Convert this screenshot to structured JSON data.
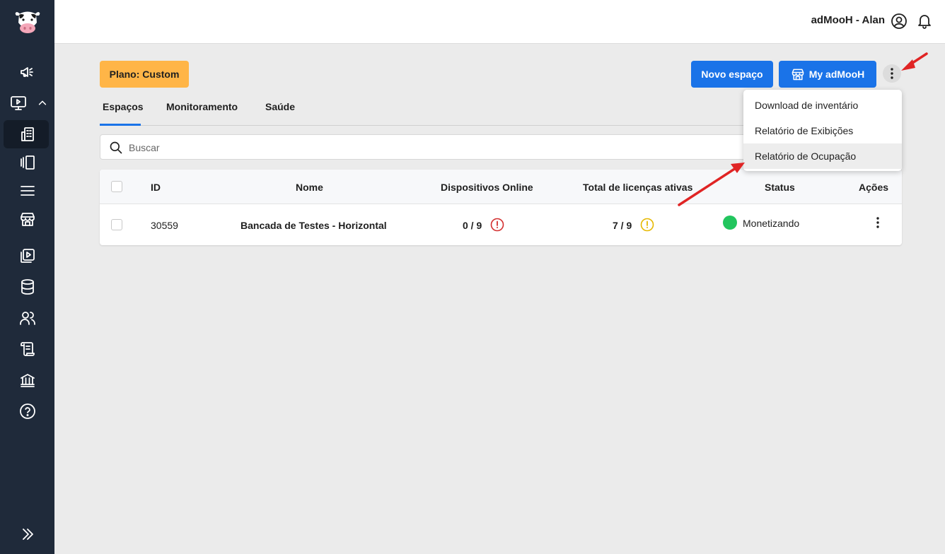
{
  "header": {
    "user_name": "adMooH - Alan",
    "icons": [
      "user-circle-icon",
      "bell-icon"
    ]
  },
  "sidebar": {
    "logo": "cow-logo-icon",
    "items": [
      {
        "icon": "megaphone-icon"
      },
      {
        "icon": "monitor-play-icon"
      },
      {
        "icon": "building-icon",
        "active": true
      },
      {
        "icon": "panels-icon"
      },
      {
        "icon": "menu-icon"
      },
      {
        "icon": "store-icon"
      },
      {
        "icon": "media-play-icon"
      },
      {
        "icon": "database-icon"
      },
      {
        "icon": "users-icon"
      },
      {
        "icon": "scroll-icon"
      },
      {
        "icon": "bank-icon"
      },
      {
        "icon": "help-icon"
      },
      {
        "icon": "double-chevron-right-icon"
      }
    ]
  },
  "plan_label": "Plano: Custom",
  "buttons": {
    "new_space": "Novo espaço",
    "my_admooh": "My adMooH"
  },
  "tabs": [
    {
      "label": "Espaços",
      "active": true
    },
    {
      "label": "Monitoramento"
    },
    {
      "label": "Saúde"
    }
  ],
  "search": {
    "placeholder": "Buscar",
    "value": ""
  },
  "table": {
    "columns": [
      "ID",
      "Nome",
      "Dispositivos Online",
      "Total de licenças ativas",
      "Status",
      "Ações"
    ],
    "rows": [
      {
        "id": "30559",
        "name": "Bancada de Testes - Horizontal",
        "devices_online": "0 / 9",
        "active_licenses": "7 / 9",
        "status": "Monetizando"
      }
    ]
  },
  "dropdown": {
    "items": [
      "Download de inventário",
      "Relatório de Exibições",
      "Relatório de Ocupação"
    ],
    "hovered_index": 2
  },
  "colors": {
    "sidebar": "#1f2a3a",
    "primary": "#1a73e8",
    "plan_badge": "#ffb547",
    "status_ok": "#22c55e",
    "alert_red": "#d32f2f",
    "alert_yellow": "#e6b800",
    "annotation_arrow": "#e02424"
  }
}
